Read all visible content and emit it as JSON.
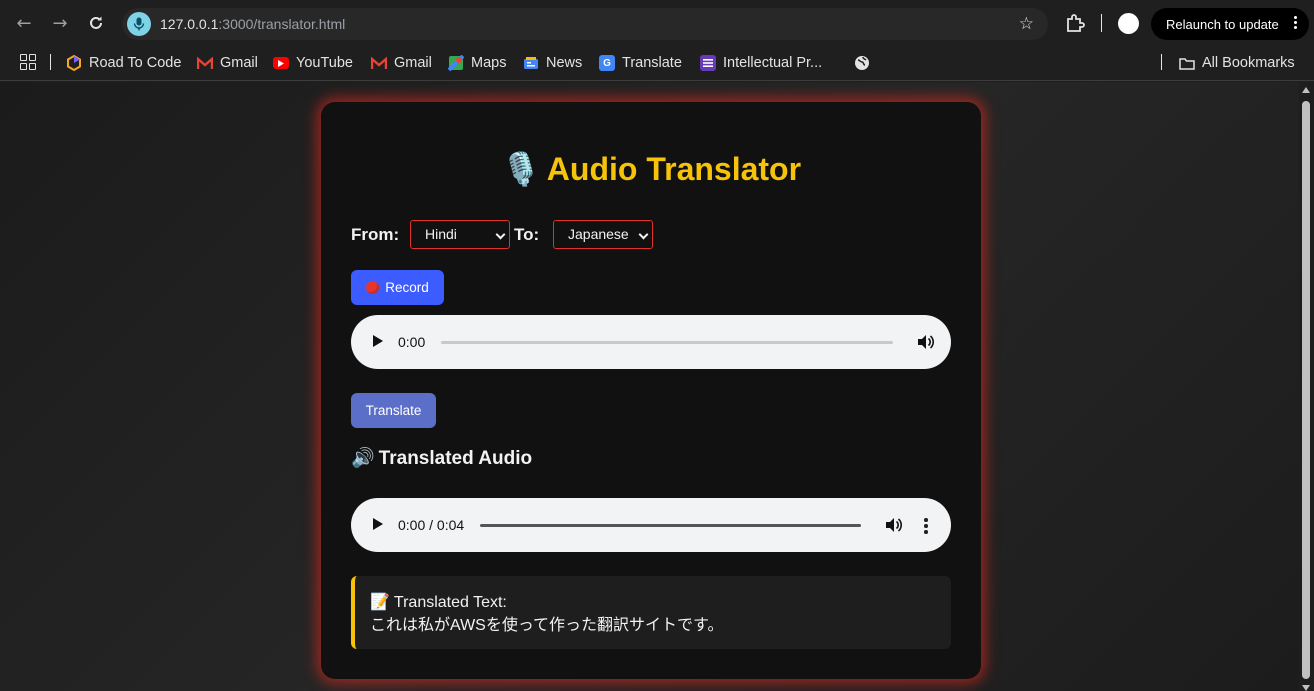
{
  "browser": {
    "url_host": "127.0.0.1",
    "url_rest": ":3000/translator.html",
    "relaunch_label": "Relaunch to update",
    "bookmarks": [
      {
        "label": "Road To Code"
      },
      {
        "label": "Gmail"
      },
      {
        "label": "YouTube"
      },
      {
        "label": "Gmail"
      },
      {
        "label": "Maps"
      },
      {
        "label": "News"
      },
      {
        "label": "Translate"
      },
      {
        "label": "Intellectual Pr..."
      }
    ],
    "all_bookmarks_label": "All Bookmarks"
  },
  "page": {
    "title": "Audio Translator",
    "from_label": "From:",
    "to_label": "To:",
    "from_value": "Hindi",
    "to_value": "Japanese",
    "record_label": "Record",
    "recorder_time": "0:00",
    "translate_label": "Translate",
    "translated_audio_heading": "Translated Audio",
    "output_time": "0:00 / 0:04",
    "translated_text_label": "Translated Text:",
    "translated_text": "これは私がAWSを使って作った翻訳サイトです。"
  },
  "colors": {
    "accent_yellow": "#f6c20a",
    "record_button": "#3c5cff",
    "translate_button": "#5b6ec8",
    "card_glow": "#c8281e",
    "select_border": "#e0312a"
  }
}
